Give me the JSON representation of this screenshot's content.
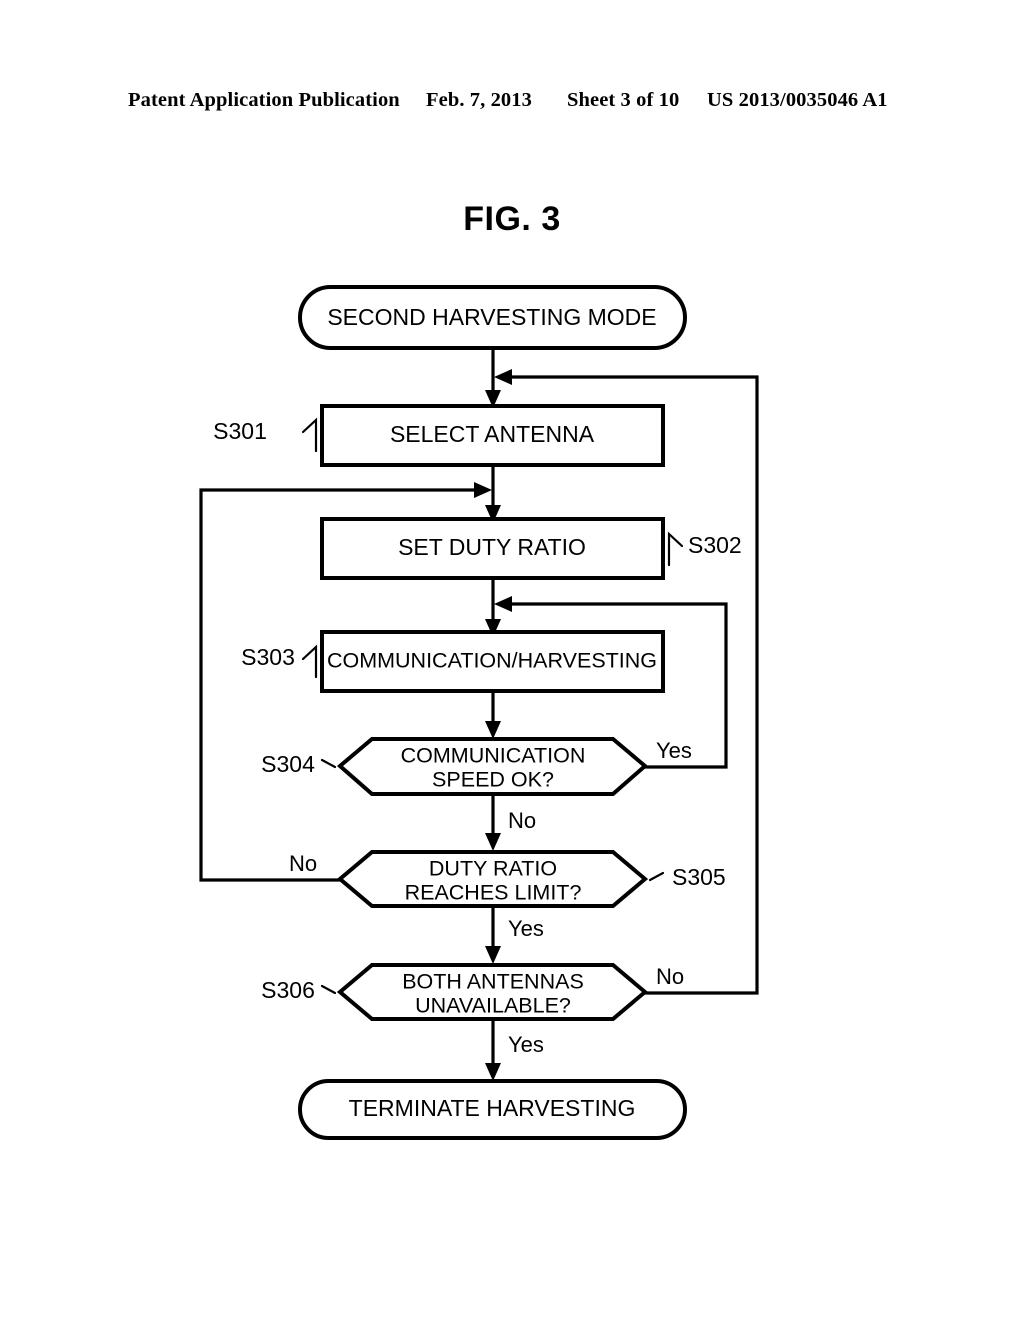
{
  "header": {
    "publication": "Patent Application Publication",
    "date": "Feb. 7, 2013",
    "sheet": "Sheet 3 of 10",
    "document_number": "US 2013/0035046 A1"
  },
  "figure": {
    "title": "FIG. 3",
    "type": "flowchart"
  },
  "chart_data": {
    "type": "diagram",
    "title": "FIG. 3",
    "nodes": [
      {
        "id": "start",
        "shape": "terminator",
        "label": "SECOND HARVESTING MODE",
        "step": ""
      },
      {
        "id": "s301",
        "shape": "process",
        "label": "SELECT ANTENNA",
        "step": "S301",
        "step_side": "left"
      },
      {
        "id": "s302",
        "shape": "process",
        "label": "SET DUTY RATIO",
        "step": "S302",
        "step_side": "right"
      },
      {
        "id": "s303",
        "shape": "process",
        "label": "COMMUNICATION/HARVESTING",
        "step": "S303",
        "step_side": "left"
      },
      {
        "id": "s304",
        "shape": "decision",
        "label_line1": "COMMUNICATION",
        "label_line2": "SPEED OK?",
        "step": "S304",
        "step_side": "left"
      },
      {
        "id": "s305",
        "shape": "decision",
        "label_line1": "DUTY RATIO",
        "label_line2": "REACHES LIMIT?",
        "step": "S305",
        "step_side": "right"
      },
      {
        "id": "s306",
        "shape": "decision",
        "label_line1": "BOTH ANTENNAS",
        "label_line2": "UNAVAILABLE?",
        "step": "S306",
        "step_side": "left"
      },
      {
        "id": "end",
        "shape": "terminator",
        "label": "TERMINATE HARVESTING",
        "step": ""
      }
    ],
    "edges": [
      {
        "from": "start",
        "to": "s301",
        "label": ""
      },
      {
        "from": "s301",
        "to": "s302",
        "label": ""
      },
      {
        "from": "s302",
        "to": "s303",
        "label": ""
      },
      {
        "from": "s303",
        "to": "s304",
        "label": ""
      },
      {
        "from": "s304",
        "to": "s305",
        "label": "No"
      },
      {
        "from": "s304",
        "to": "s303",
        "label": "Yes"
      },
      {
        "from": "s305",
        "to": "s306",
        "label": "Yes"
      },
      {
        "from": "s305",
        "to": "s302",
        "label": "No"
      },
      {
        "from": "s306",
        "to": "end",
        "label": "Yes"
      },
      {
        "from": "s306",
        "to": "s301",
        "label": "No"
      }
    ],
    "branch_labels": {
      "s304_yes": "Yes",
      "s304_no": "No",
      "s305_no": "No",
      "s305_yes": "Yes",
      "s306_no": "No",
      "s306_yes": "Yes"
    },
    "step_labels": {
      "s301": "S301",
      "s302": "S302",
      "s303": "S303",
      "s304": "S304",
      "s305": "S305",
      "s306": "S306"
    },
    "colors": {
      "stroke": "#000000",
      "fill": "#ffffff",
      "text": "#000000"
    }
  }
}
